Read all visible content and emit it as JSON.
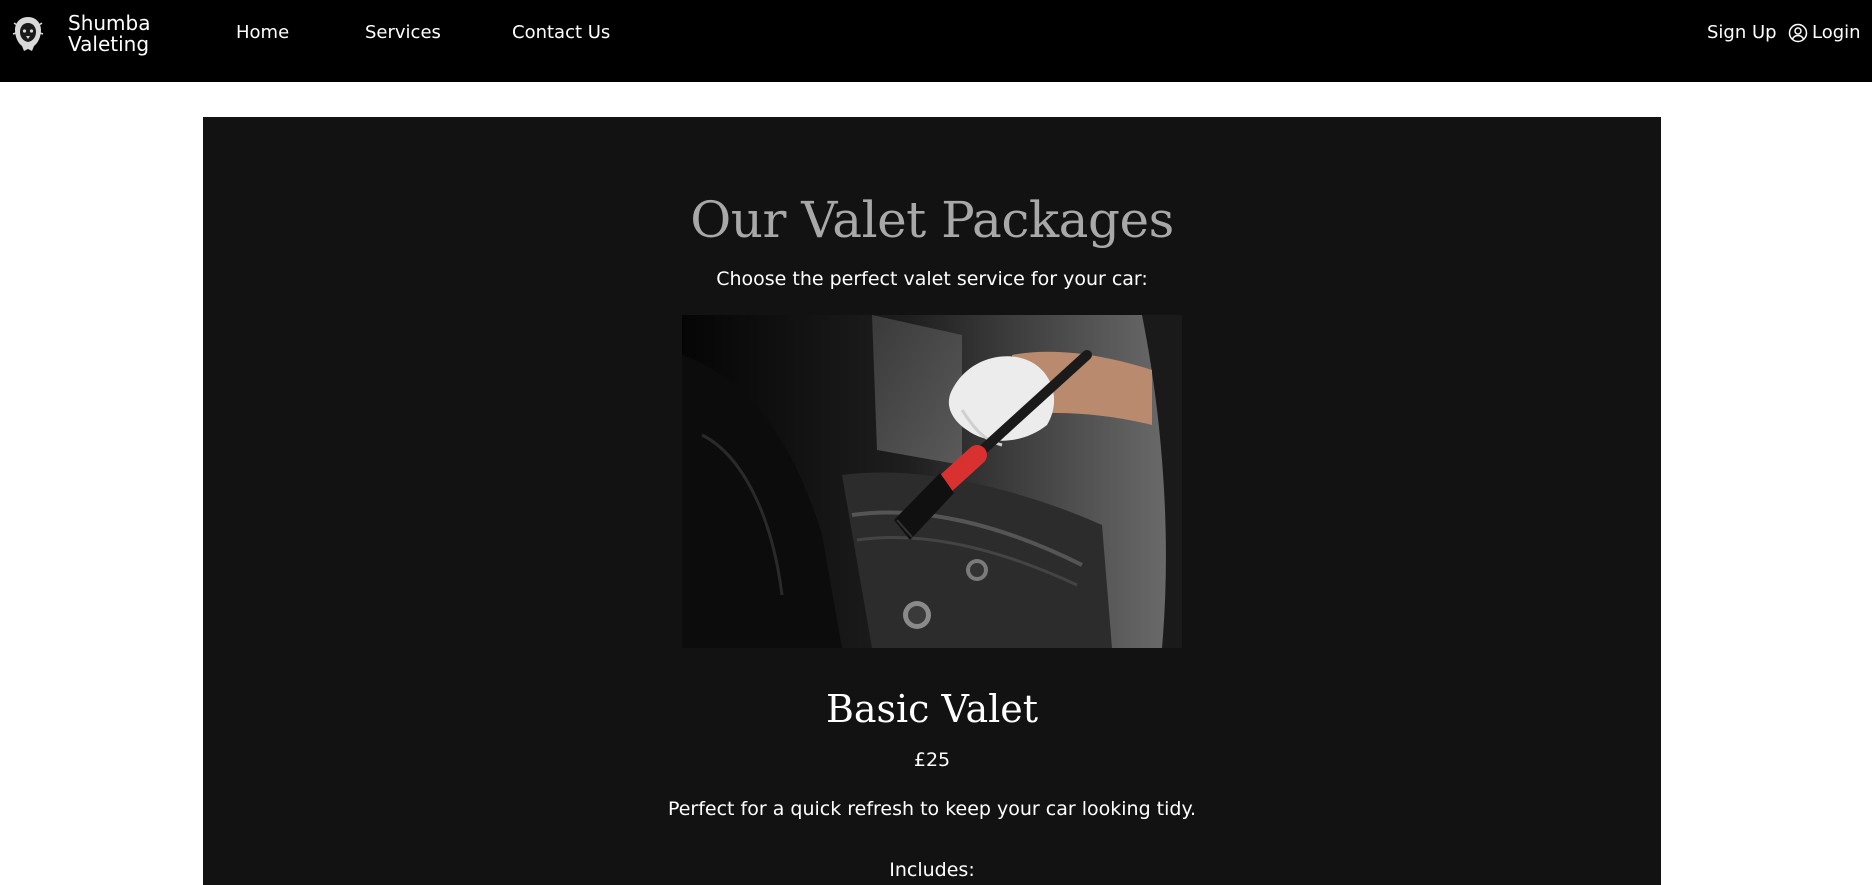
{
  "nav": {
    "brand_line1": "Shumba",
    "brand_line2": "Valeting",
    "links": [
      "Home",
      "Services",
      "Contact Us"
    ],
    "signup": "Sign Up",
    "login": "Login"
  },
  "main": {
    "title": "Our Valet Packages",
    "subtitle": "Choose the perfect valet service for your car:",
    "package": {
      "name": "Basic Valet",
      "price": "£25",
      "description": "Perfect for a quick refresh to keep your car looking tidy.",
      "includes_label": "Includes:"
    }
  },
  "colors": {
    "nav_bg": "#000000",
    "panel_bg": "#121212",
    "title_color": "#a8a8a8",
    "brush_red": "#d93030"
  },
  "icons": {
    "logo": "lion-head-icon",
    "login": "user-circle-icon"
  }
}
